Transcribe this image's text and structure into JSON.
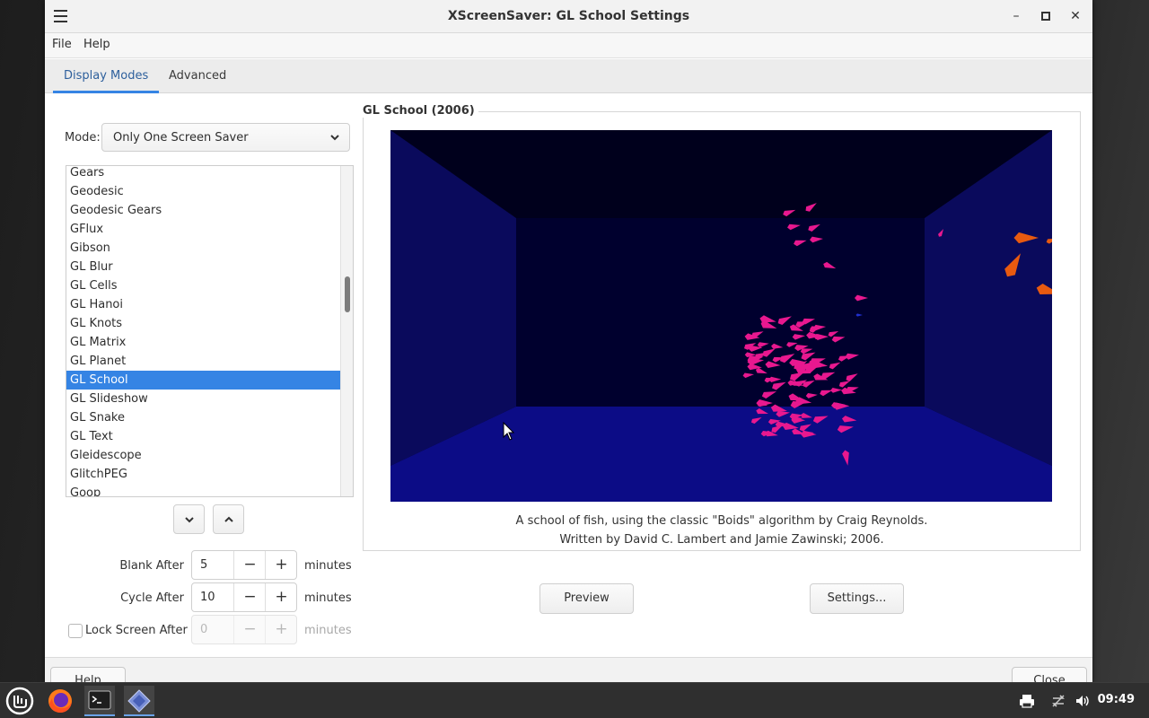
{
  "window": {
    "title": "XScreenSaver: GL School Settings",
    "controls": {
      "minimize": "–",
      "maximize": "▫",
      "close": "✕"
    }
  },
  "menubar": {
    "items": [
      "File",
      "Help"
    ]
  },
  "tabs": [
    {
      "label": "Display Modes",
      "active": true
    },
    {
      "label": "Advanced",
      "active": false
    }
  ],
  "mode": {
    "label": "Mode:",
    "selected": "Only One Screen Saver"
  },
  "savers": {
    "items": [
      "Gears",
      "Geodesic",
      "Geodesic Gears",
      "GFlux",
      "Gibson",
      "GL Blur",
      "GL Cells",
      "GL Hanoi",
      "GL Knots",
      "GL Matrix",
      "GL Planet",
      "GL School",
      "GL Slideshow",
      "GL Snake",
      "GL Text",
      "Gleidescope",
      "GlitchPEG",
      "Goop"
    ],
    "selected": "GL School"
  },
  "timing": {
    "blank": {
      "label": "Blank After",
      "value": "5",
      "unit": "minutes"
    },
    "cycle": {
      "label": "Cycle After",
      "value": "10",
      "unit": "minutes"
    },
    "lock": {
      "label": "Lock Screen After",
      "value": "0",
      "unit": "minutes",
      "checked": false
    }
  },
  "stepper": {
    "minus": "−",
    "plus": "+"
  },
  "preview": {
    "frame_title": "GL School (2006)",
    "description_line1": "A school of fish, using the classic \"Boids\" algorithm by Craig Reynolds.",
    "description_line2": "Written by David C. Lambert and Jamie Zawinski; 2006."
  },
  "buttons": {
    "preview": "Preview",
    "settings": "Settings...",
    "help": "Help",
    "close": "Close"
  },
  "taskbar": {
    "clock": "09:49"
  },
  "colors": {
    "accent": "#3584e4",
    "fish": "#e8188f",
    "fish_orange": "#e85a10",
    "aquarium_floor": "#0c0c86"
  }
}
